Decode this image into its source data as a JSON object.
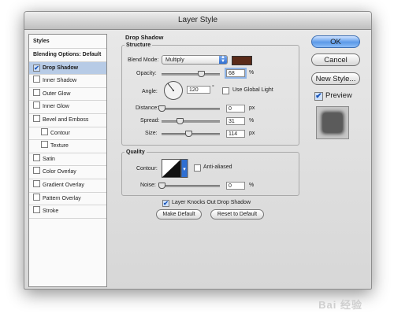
{
  "window": {
    "title": "Layer Style"
  },
  "sidebar": {
    "items": [
      {
        "label": "Styles",
        "type": "header",
        "checked": false
      },
      {
        "label": "Blending Options: Default",
        "type": "header",
        "checked": false
      },
      {
        "label": "Drop Shadow",
        "type": "check",
        "checked": true,
        "selected": true
      },
      {
        "label": "Inner Shadow",
        "type": "check",
        "checked": false
      },
      {
        "label": "Outer Glow",
        "type": "check",
        "checked": false
      },
      {
        "label": "Inner Glow",
        "type": "check",
        "checked": false
      },
      {
        "label": "Bevel and Emboss",
        "type": "check",
        "checked": false
      },
      {
        "label": "Contour",
        "type": "check",
        "checked": false,
        "indent": true
      },
      {
        "label": "Texture",
        "type": "check",
        "checked": false,
        "indent": true
      },
      {
        "label": "Satin",
        "type": "check",
        "checked": false
      },
      {
        "label": "Color Overlay",
        "type": "check",
        "checked": false
      },
      {
        "label": "Gradient Overlay",
        "type": "check",
        "checked": false
      },
      {
        "label": "Pattern Overlay",
        "type": "check",
        "checked": false
      },
      {
        "label": "Stroke",
        "type": "check",
        "checked": false
      }
    ]
  },
  "drop_shadow": {
    "title": "Drop Shadow",
    "structure_title": "Structure",
    "blend_mode_label": "Blend Mode:",
    "blend_mode_value": "Multiply",
    "shadow_color": "#5a2a18",
    "opacity_label": "Opacity:",
    "opacity_value": "68",
    "opacity_unit": "%",
    "opacity_level": 0.68,
    "angle_label": "Angle:",
    "angle_value": "120",
    "angle_unit": "°",
    "use_global_light_label": "Use Global Light",
    "use_global_light_checked": false,
    "distance_label": "Distance:",
    "distance_value": "0",
    "distance_unit": "px",
    "distance_level": 0.0,
    "spread_label": "Spread:",
    "spread_value": "31",
    "spread_unit": "%",
    "spread_level": 0.31,
    "size_label": "Size:",
    "size_value": "114",
    "size_unit": "px",
    "size_level": 0.46
  },
  "quality": {
    "title": "Quality",
    "contour_label": "Contour:",
    "anti_aliased_label": "Anti-aliased",
    "anti_aliased_checked": false,
    "noise_label": "Noise:",
    "noise_value": "0",
    "noise_unit": "%",
    "noise_level": 0.0
  },
  "knockout": {
    "label": "Layer Knocks Out Drop Shadow",
    "checked": true
  },
  "buttons": {
    "make_default": "Make Default",
    "reset_to_default": "Reset to Default",
    "ok": "OK",
    "cancel": "Cancel",
    "new_style": "New Style..."
  },
  "preview": {
    "label": "Preview",
    "checked": true,
    "swatch_color": "#5b5b5b"
  },
  "watermark": "Bai 经验"
}
